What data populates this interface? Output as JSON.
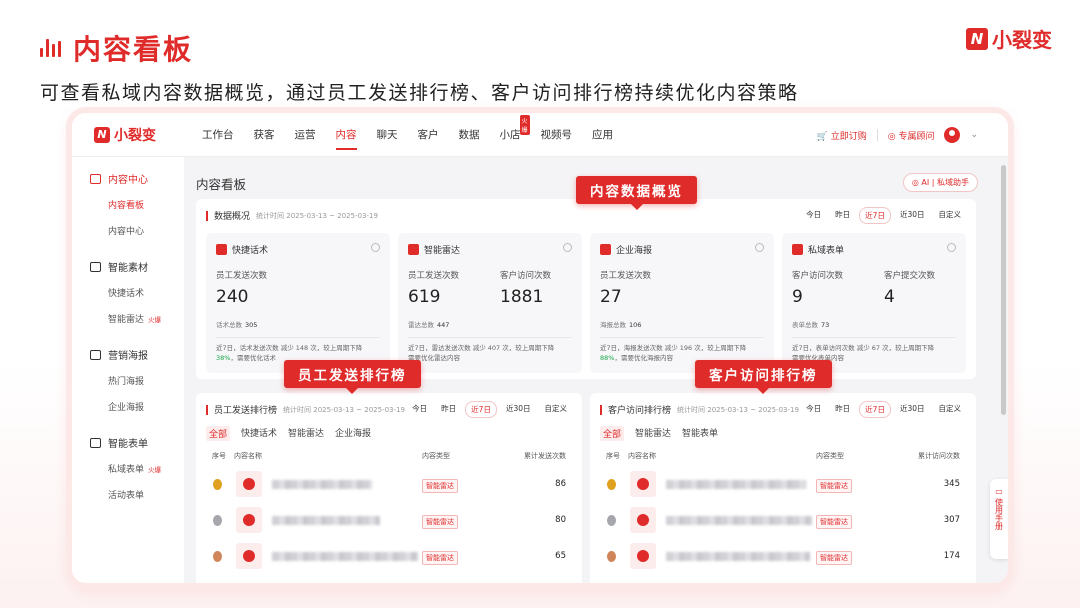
{
  "slide": {
    "title": "内容看板",
    "subtitle": "可查看私域内容数据概览，通过员工发送排行榜、客户访问排行榜持续优化内容策略",
    "brand": "小裂变"
  },
  "callouts": {
    "overview": "内容数据概览",
    "employee_rank": "员工发送排行榜",
    "customer_rank": "客户访问排行榜"
  },
  "app": {
    "logo": "小裂变",
    "nav": [
      "工作台",
      "获客",
      "运营",
      "内容",
      "聊天",
      "客户",
      "数据",
      "小店",
      "视频号",
      "应用"
    ],
    "nav_active": "内容",
    "nav_hot_badge": "火爆",
    "order_link": "立即订购",
    "advisor_link": "专属顾问"
  },
  "sidebar": {
    "groups": [
      {
        "title": "内容中心",
        "items": [
          "内容看板",
          "内容中心"
        ]
      },
      {
        "title": "智能素材",
        "items": [
          "快捷话术",
          "智能雷达"
        ]
      },
      {
        "title": "营销海报",
        "items": [
          "热门海报",
          "企业海报"
        ]
      },
      {
        "title": "智能表单",
        "items": [
          "私域表单",
          "活动表单"
        ]
      }
    ],
    "hot": "火爆"
  },
  "main": {
    "page_title": "内容看板",
    "ai_button": "AI | 私域助手",
    "overview": {
      "title": "数据概况",
      "meta": "统计时间 2025-03-13 ~ 2025-03-19",
      "ranges": [
        "今日",
        "昨日",
        "近7日",
        "近30日",
        "自定义"
      ],
      "cards": [
        {
          "name": "快捷话术",
          "l1": "员工发送次数",
          "v1": "240",
          "l2": "",
          "v2": "",
          "total_label": "话术总数",
          "total": "305",
          "note": "近7日，话术发送次数 减少 148 次，较上周期下降",
          "pct": "38%",
          "note2": "，需要优化话术"
        },
        {
          "name": "智能雷达",
          "l1": "员工发送次数",
          "v1": "619",
          "l2": "客户访问次数",
          "v2": "1881",
          "total_label": "雷达总数",
          "total": "447",
          "note": "近7日，雷达发送次数 减少 407 次，较上周期下降",
          "pct": "",
          "note2": "需要优化雷达内容"
        },
        {
          "name": "企业海报",
          "l1": "员工发送次数",
          "v1": "27",
          "l2": "",
          "v2": "",
          "total_label": "海报总数",
          "total": "106",
          "note": "近7日，海报发送次数 减少 196 次，较上周期下降",
          "pct": "88%",
          "note2": "，需要优化海报内容"
        },
        {
          "name": "私域表单",
          "l1": "客户访问次数",
          "v1": "9",
          "l2": "客户提交次数",
          "v2": "4",
          "total_label": "表单总数",
          "total": "73",
          "note": "近7日，表单访问次数 减少 67 次，较上周期下降",
          "pct": "",
          "note2": "需要优化表单内容"
        }
      ]
    },
    "employee_rank": {
      "title": "员工发送排行榜",
      "meta": "统计时间 2025-03-13 ~ 2025-03-19",
      "ranges": [
        "今日",
        "昨日",
        "近7日",
        "近30日",
        "自定义"
      ],
      "tabs": [
        "全部",
        "快捷话术",
        "智能雷达",
        "企业海报"
      ],
      "cols": [
        "序号",
        "内容名称",
        "内容类型",
        "累计发送次数"
      ],
      "rows": [
        {
          "type": "智能雷达",
          "count": "86"
        },
        {
          "type": "智能雷达",
          "count": "80"
        },
        {
          "type": "智能雷达",
          "count": "65"
        }
      ]
    },
    "customer_rank": {
      "title": "客户访问排行榜",
      "meta": "统计时间 2025-03-13 ~ 2025-03-19",
      "ranges": [
        "今日",
        "昨日",
        "近7日",
        "近30日",
        "自定义"
      ],
      "tabs": [
        "全部",
        "智能雷达",
        "智能表单"
      ],
      "cols": [
        "序号",
        "内容名称",
        "内容类型",
        "累计访问次数"
      ],
      "rows": [
        {
          "type": "智能雷达",
          "count": "345"
        },
        {
          "type": "智能雷达",
          "count": "307"
        },
        {
          "type": "智能雷达",
          "count": "174"
        }
      ]
    },
    "manual_tab": "使用手册"
  },
  "colors": {
    "accent": "#e02b2b",
    "positive": "#1aa34a",
    "gold": "#e0a020",
    "silver": "#a6a6ad",
    "bronze": "#d0855a"
  }
}
